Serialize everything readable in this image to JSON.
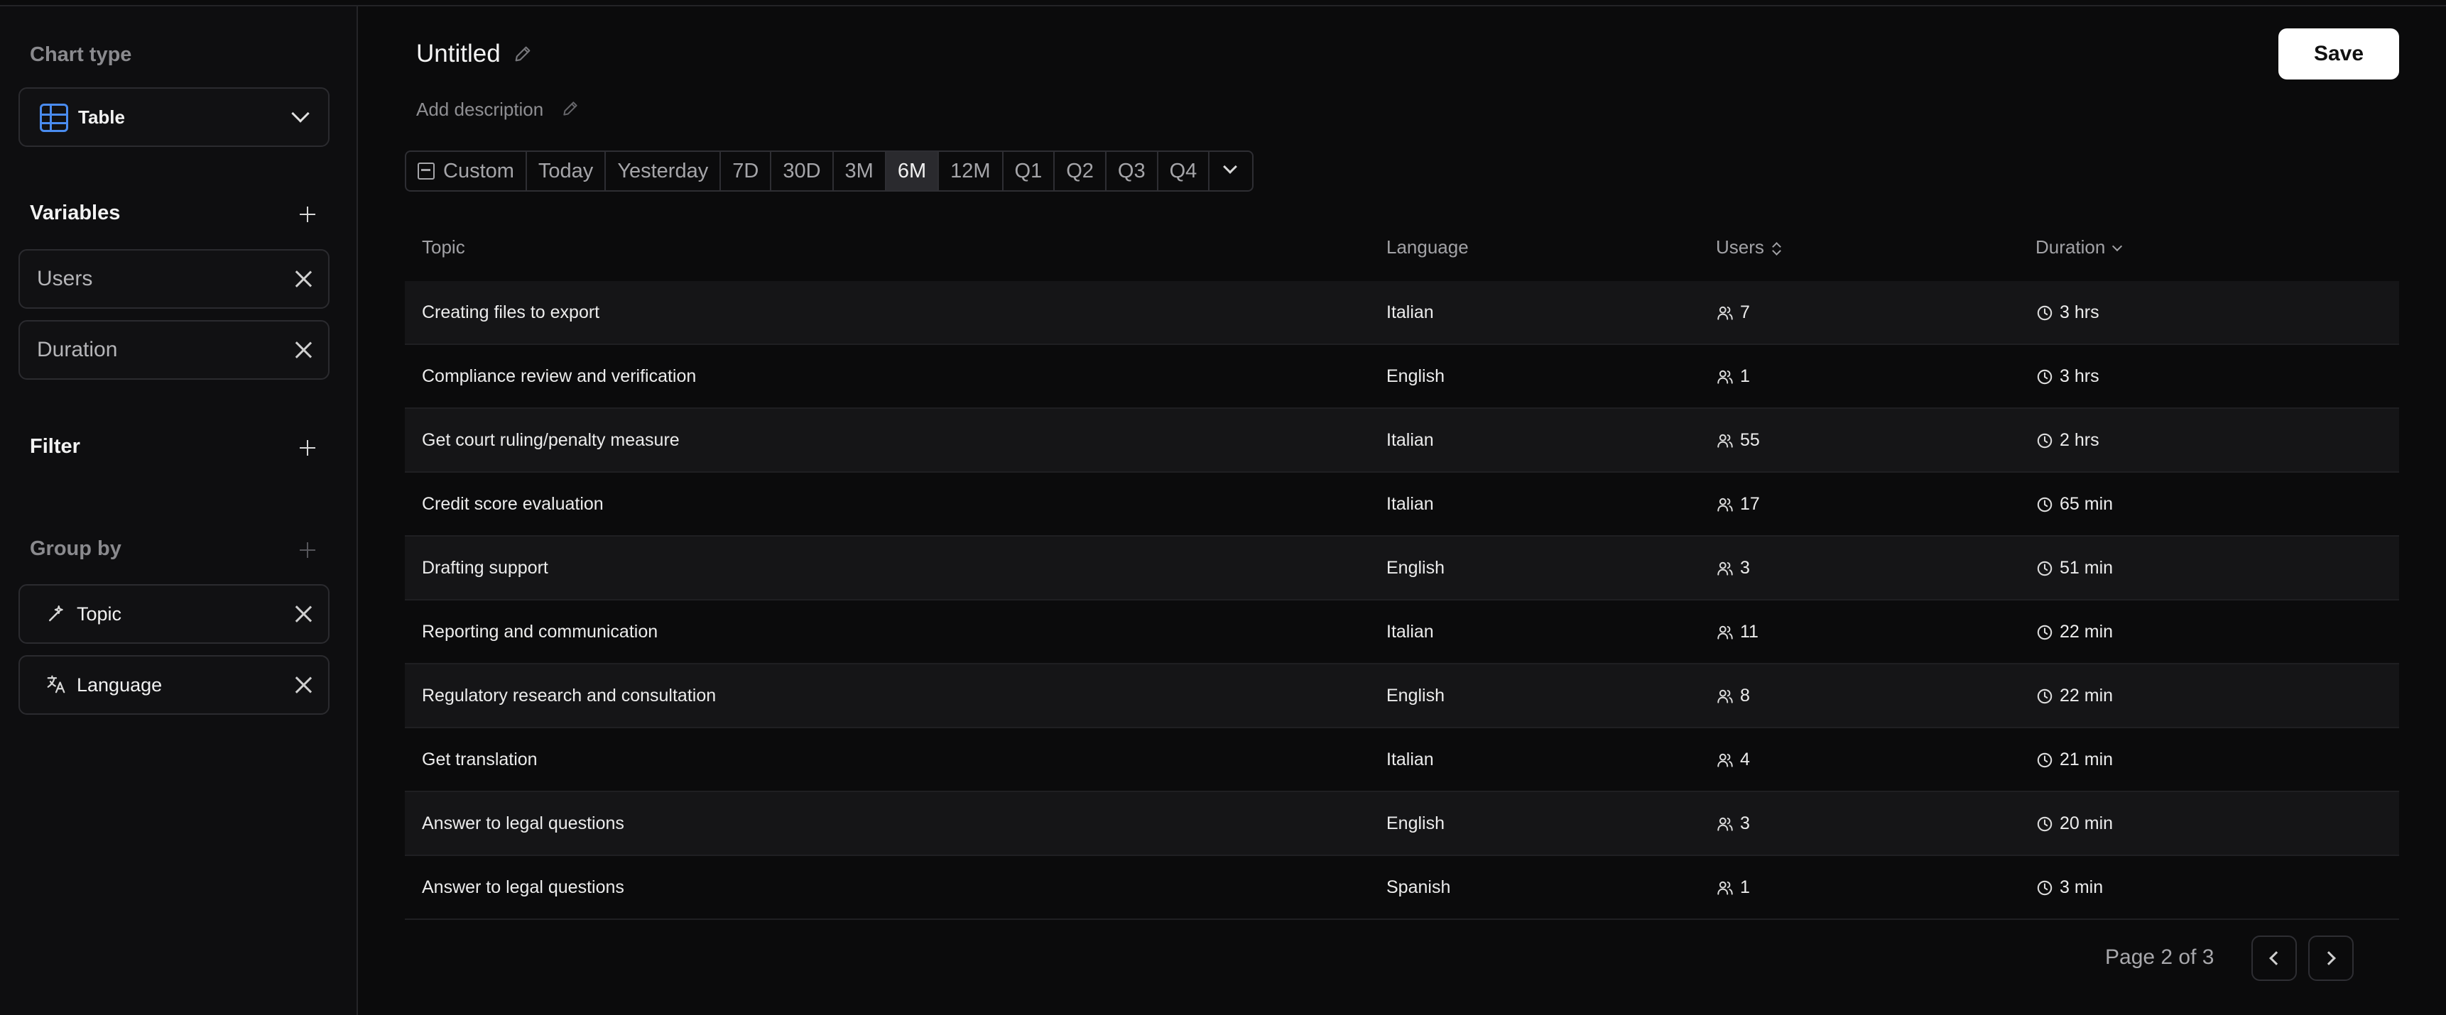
{
  "sidebar": {
    "chart_type_title": "Chart type",
    "chart_type_value": "Table",
    "variables_title": "Variables",
    "variables": [
      "Users",
      "Duration"
    ],
    "filter_title": "Filter",
    "group_by_title": "Group by",
    "group_by": [
      "Topic",
      "Language"
    ]
  },
  "header": {
    "title": "Untitled",
    "description_placeholder": "Add description",
    "save_label": "Save"
  },
  "date_range": {
    "custom": "Custom",
    "options": [
      "Today",
      "Yesterday",
      "7D",
      "30D",
      "3M",
      "6M",
      "12M",
      "Q1",
      "Q2",
      "Q3",
      "Q4"
    ],
    "selected": "6M"
  },
  "table": {
    "columns": [
      "Topic",
      "Language",
      "Users",
      "Duration"
    ],
    "rows": [
      {
        "topic": "Creating files to export",
        "language": "Italian",
        "users": "7",
        "duration": "3 hrs"
      },
      {
        "topic": "Compliance review and verification",
        "language": "English",
        "users": "1",
        "duration": "3 hrs"
      },
      {
        "topic": "Get court ruling/penalty measure",
        "language": "Italian",
        "users": "55",
        "duration": "2 hrs"
      },
      {
        "topic": "Credit score evaluation",
        "language": "Italian",
        "users": "17",
        "duration": "65 min"
      },
      {
        "topic": "Drafting support",
        "language": "English",
        "users": "3",
        "duration": "51 min"
      },
      {
        "topic": "Reporting and communication",
        "language": "Italian",
        "users": "11",
        "duration": "22 min"
      },
      {
        "topic": "Regulatory research and consultation",
        "language": "English",
        "users": "8",
        "duration": "22 min"
      },
      {
        "topic": "Get translation",
        "language": "Italian",
        "users": "4",
        "duration": "21 min"
      },
      {
        "topic": "Answer to legal questions",
        "language": "English",
        "users": "3",
        "duration": "20 min"
      },
      {
        "topic": "Answer to legal questions",
        "language": "Spanish",
        "users": "1",
        "duration": "3 min"
      }
    ]
  },
  "pagination": {
    "text": "Page 2 of 3"
  },
  "icons": {
    "table": "table-icon",
    "users": "users-icon",
    "duration": "clock-icon",
    "topic": "wand-icon",
    "language": "translate-icon",
    "calendar": "calendar-icon"
  },
  "colors": {
    "accent": "#4a8cf0",
    "background": "#0b0b0c",
    "active_segment": "#2a2a2e"
  }
}
